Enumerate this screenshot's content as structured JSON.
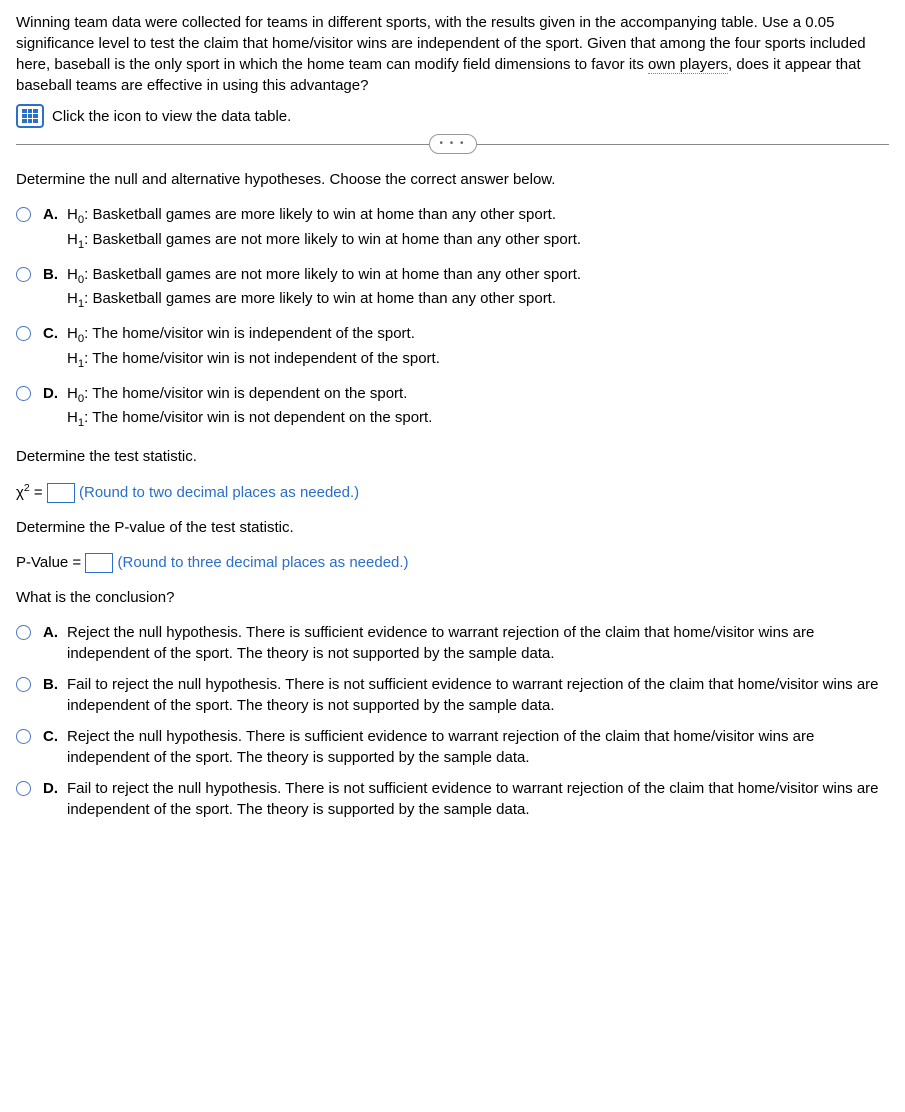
{
  "intro": {
    "paragraph": "Winning team data were collected for teams in different sports, with the results given in the accompanying table. Use a 0.05 significance level to test the claim that home/visitor wins are independent of the sport. Given that among the four sports included here, baseball is the only sport in which the home team can modify field dimensions to favor its own players, does it appear that baseball teams are effective in using this advantage?",
    "link_text": "Click the icon to view the data table.",
    "dotted_phrase": "own players"
  },
  "divider_dots": "• • •",
  "q1": {
    "prompt": "Determine the null and alternative hypotheses. Choose the correct answer below.",
    "options": [
      {
        "letter": "A.",
        "h0": "Basketball games are more likely to win at home than any other sport.",
        "h1": "Basketball games are not more likely to win at home than any other sport."
      },
      {
        "letter": "B.",
        "h0": "Basketball games are not more likely to win at home than any other sport.",
        "h1": "Basketball games are more likely to win at home than any other sport."
      },
      {
        "letter": "C.",
        "h0": "The home/visitor win is independent of the sport.",
        "h1": "The home/visitor win is not independent of the sport."
      },
      {
        "letter": "D.",
        "h0": "The home/visitor win is dependent on the sport.",
        "h1": "The home/visitor win is not dependent on the sport."
      }
    ],
    "h0_label": "H",
    "h0_sub": "0",
    "h1_label": "H",
    "h1_sub": "1"
  },
  "q2": {
    "prompt": "Determine the test statistic.",
    "symbol": "χ",
    "sup": "2",
    "equals": " = ",
    "note": "(Round to two decimal places as needed.)"
  },
  "q3": {
    "prompt": "Determine the P-value of the test statistic.",
    "label": "P-Value = ",
    "note": "(Round to three decimal places as needed.)"
  },
  "q4": {
    "prompt": "What is the conclusion?",
    "options": [
      {
        "letter": "A.",
        "text": "Reject the null hypothesis. There is sufficient evidence to warrant rejection of the claim that home/visitor wins are independent of the sport. The theory is not supported by the sample data."
      },
      {
        "letter": "B.",
        "text": "Fail to reject the null hypothesis. There is not sufficient evidence to warrant rejection of the claim that home/visitor wins are independent of the sport. The theory is not supported by the sample data."
      },
      {
        "letter": "C.",
        "text": "Reject the null hypothesis. There is sufficient evidence to warrant rejection of the claim that home/visitor wins are independent of the sport. The theory is supported by the sample data."
      },
      {
        "letter": "D.",
        "text": "Fail to reject the null hypothesis. There is not sufficient evidence to warrant rejection of the claim that home/visitor wins are independent of the sport. The theory is supported by the sample data."
      }
    ]
  }
}
